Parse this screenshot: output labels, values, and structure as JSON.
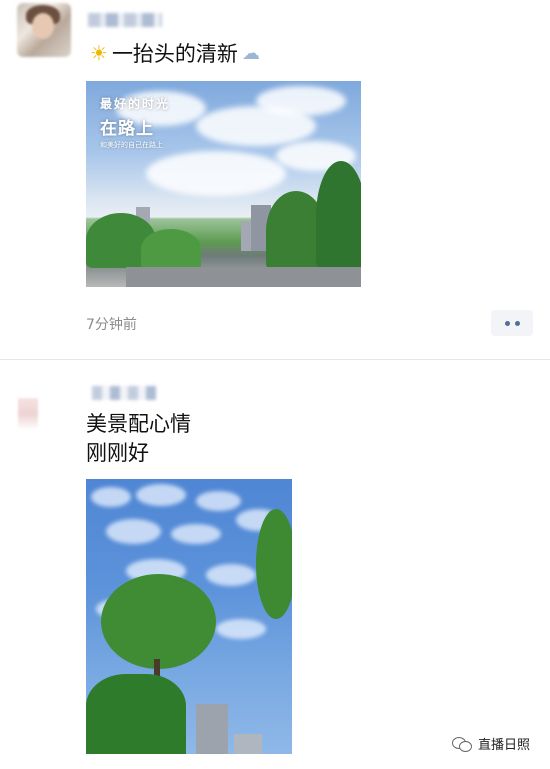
{
  "post1": {
    "caption": "一抬头的清新",
    "icons": [
      "sun-emoji",
      "cloud-emoji"
    ],
    "photo_overlay": {
      "line1": "最好的时光",
      "line2": "在路上",
      "line3": "和美好的自己在路上"
    },
    "time": "7分钟前",
    "more_icon": "two-dots-icon"
  },
  "post2": {
    "caption_line1": "美景配心情",
    "caption_line2": "刚刚好"
  },
  "watermark": {
    "icon": "wechat-icon",
    "text": "直播日照"
  },
  "colors": {
    "link_blue": "#526e9a",
    "time_gray": "#8c8c8c",
    "button_bg": "#f3f4f7"
  }
}
